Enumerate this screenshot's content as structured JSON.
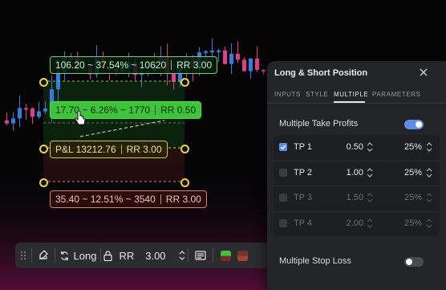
{
  "colors": {
    "bull": "#2f7fe0",
    "bear": "#e23d8c",
    "tp_green": "#3ec43a",
    "pnl_yellow": "#f0d23a",
    "sl_salmon": "#d28474",
    "panel_bg": "#232428",
    "toggle_on": "#5b8def"
  },
  "chart": {
    "tp_main_label": {
      "price": "106.20 ~ 37.54% ~ 10620",
      "rr": "RR 3.00"
    },
    "tp1_label": {
      "price": "17.70 ~ 6.26% ~ 1770",
      "rr": "RR 0.50"
    },
    "pnl_label": {
      "pnl": "P&L 13212.76",
      "rr": "RR 3.00"
    },
    "sl_label": {
      "price": "35.40 ~ 12.51% ~ 3540",
      "rr": "RR 3.00"
    }
  },
  "toolbar": {
    "drag_icon": "drag-handle-icon",
    "direction_label": "Long",
    "rr_label": "RR",
    "rr_value": "3.00"
  },
  "panel": {
    "title": "Long & Short Position",
    "tabs": [
      "INPUTS",
      "STYLE",
      "MULTIPLE",
      "PARAMETERS"
    ],
    "active_tab": "MULTIPLE",
    "multiple_tp_label": "Multiple Take Profits",
    "multiple_tp_enabled": true,
    "tp_rows": [
      {
        "name": "TP 1",
        "value": "0.50",
        "percent": "25%",
        "checked": true,
        "enabled": true
      },
      {
        "name": "TP 2",
        "value": "1.00",
        "percent": "25%",
        "checked": false,
        "enabled": true
      },
      {
        "name": "TP 3",
        "value": "1.50",
        "percent": "25%",
        "checked": false,
        "enabled": false
      },
      {
        "name": "TP 4",
        "value": "2.00",
        "percent": "25%",
        "checked": false,
        "enabled": false
      }
    ],
    "multiple_sl_label": "Multiple Stop Loss",
    "multiple_sl_enabled": false
  }
}
